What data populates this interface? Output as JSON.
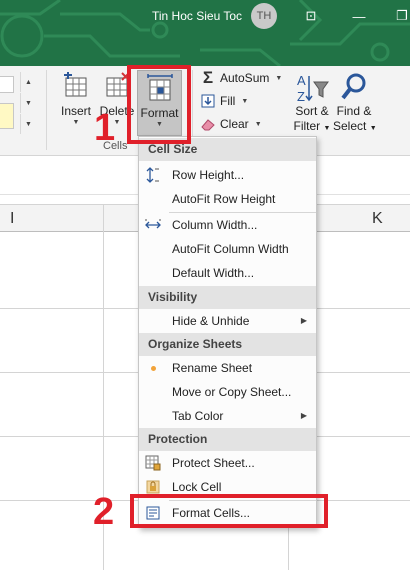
{
  "titlebar": {
    "user_name": "Tin Hoc Sieu Toc",
    "avatar_initials": "TH",
    "ribbon_display_glyph": "⊡",
    "minimize_glyph": "—",
    "restore_glyph": "❐"
  },
  "ribbon": {
    "cells_group_label": "Cells",
    "insert_label": "Insert",
    "delete_label": "Delete",
    "format_label": "Format",
    "autosum_label": "AutoSum",
    "fill_label": "Fill",
    "clear_label": "Clear",
    "sort_filter_label_1": "Sort &",
    "sort_filter_label_2": "Filter",
    "find_select_label_1": "Find &",
    "find_select_label_2": "Select"
  },
  "sheet": {
    "columns": [
      "I",
      "K"
    ]
  },
  "format_menu": {
    "sections": {
      "cell_size": "Cell Size",
      "visibility": "Visibility",
      "organize_sheets": "Organize Sheets",
      "protection": "Protection"
    },
    "items": {
      "row_height": "Row Height...",
      "autofit_row_height": "AutoFit Row Height",
      "column_width": "Column Width...",
      "autofit_column_width": "AutoFit Column Width",
      "default_width": "Default Width...",
      "hide_unhide": "Hide & Unhide",
      "rename_sheet": "Rename Sheet",
      "move_copy_sheet": "Move or Copy Sheet...",
      "tab_color": "Tab Color",
      "protect_sheet": "Protect Sheet...",
      "lock_cell": "Lock Cell",
      "format_cells": "Format Cells..."
    }
  },
  "annotations": {
    "step_1": "1",
    "step_2": "2"
  },
  "colors": {
    "title_bar": "#217346",
    "highlight_red": "#e0202a",
    "menu_header": "#e3e3e3",
    "icon_blue": "#2b579a"
  }
}
